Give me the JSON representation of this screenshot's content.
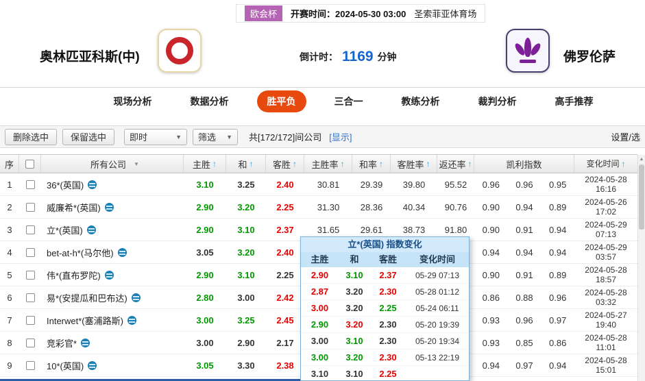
{
  "colors": {
    "tab": "#e8490f",
    "up": "#e60000",
    "down": "#009900",
    "flat": "#333333",
    "countdown": "#1565d0",
    "link": "#2a6fd0",
    "badge": "#b564b5",
    "sort": "#2aa5dc"
  },
  "icons": {
    "sort_arrow": "↑",
    "dropdown_arrow": "▼",
    "company_filter": "▼",
    "scroll_up": "▲"
  },
  "match_header": {
    "league_badge": "欧会杯",
    "kickoff": "开赛时间：2024-05-30 03:00",
    "venue": "圣索菲亚体育场",
    "home_team": "奥林匹亚科斯(中)",
    "away_team": "佛罗伦萨",
    "countdown_label": "倒计时：",
    "countdown_value": "1169",
    "countdown_unit": "分钟"
  },
  "tabs": {
    "items": [
      {
        "label": "现场分析",
        "state": "normal"
      },
      {
        "label": "数据分析",
        "state": "normal"
      },
      {
        "label": "胜平负",
        "state": "active"
      },
      {
        "label": "三合一",
        "state": "normal"
      },
      {
        "label": "教练分析",
        "state": "normal"
      },
      {
        "label": "裁判分析",
        "state": "normal"
      },
      {
        "label": "高手推荐",
        "state": "normal"
      }
    ]
  },
  "toolbar": {
    "delete_button": "删除选中",
    "keep_button": "保留选中",
    "time_select": "即时",
    "filter_select": "筛选",
    "company_count": "共[172/172]间公司",
    "show_link": "[显示]",
    "settings_link": "设置/选"
  },
  "table": {
    "headers": {
      "seq": "序",
      "company": "所有公司",
      "home": "主胜",
      "draw": "和",
      "away": "客胜",
      "home_rate": "主胜率",
      "draw_rate": "和率",
      "away_rate": "客胜率",
      "return_rate": "返还率",
      "kelly": "凯利指数",
      "change_time": "变化时间"
    },
    "rows": [
      {
        "seq": "1",
        "company": "36*(英国)",
        "home": "3.10",
        "home_trend": "down",
        "draw": "3.25",
        "draw_trend": "flat",
        "away": "2.40",
        "away_trend": "up",
        "home_rate": "30.81",
        "draw_rate": "29.39",
        "away_rate": "39.80",
        "return_rate": "95.52",
        "kelly_home": "0.96",
        "kelly_draw": "0.96",
        "kelly_away": "0.95",
        "change_date": "2024-05-28",
        "change_time": "16:16"
      },
      {
        "seq": "2",
        "company": "威廉希*(英国)",
        "home": "2.90",
        "home_trend": "down",
        "draw": "3.20",
        "draw_trend": "down",
        "away": "2.25",
        "away_trend": "up",
        "home_rate": "31.30",
        "draw_rate": "28.36",
        "away_rate": "40.34",
        "return_rate": "90.76",
        "kelly_home": "0.90",
        "kelly_draw": "0.94",
        "kelly_away": "0.89",
        "change_date": "2024-05-26",
        "change_time": "17:02"
      },
      {
        "seq": "3",
        "company": "立*(英国)",
        "home": "2.90",
        "home_trend": "down",
        "draw": "3.10",
        "draw_trend": "down",
        "away": "2.37",
        "away_trend": "up",
        "home_rate": "31.65",
        "draw_rate": "29.61",
        "away_rate": "38.73",
        "return_rate": "91.80",
        "kelly_home": "0.90",
        "kelly_draw": "0.91",
        "kelly_away": "0.94",
        "change_date": "2024-05-29",
        "change_time": "07:13"
      },
      {
        "seq": "4",
        "company": "bet-at-h*(马尔他)",
        "home": "3.05",
        "home_trend": "flat",
        "draw": "3.20",
        "draw_trend": "down",
        "away": "2.40",
        "away_trend": "up",
        "home_rate": "",
        "draw_rate": "",
        "away_rate": "",
        "return_rate": "",
        "kelly_home": "0.94",
        "kelly_draw": "0.94",
        "kelly_away": "0.94",
        "change_date": "2024-05-29",
        "change_time": "03:57"
      },
      {
        "seq": "5",
        "company": "伟*(直布罗陀)",
        "home": "2.90",
        "home_trend": "down",
        "draw": "3.10",
        "draw_trend": "down",
        "away": "2.25",
        "away_trend": "flat",
        "home_rate": "",
        "draw_rate": "",
        "away_rate": "",
        "return_rate": "",
        "kelly_home": "0.90",
        "kelly_draw": "0.91",
        "kelly_away": "0.89",
        "change_date": "2024-05-28",
        "change_time": "18:57"
      },
      {
        "seq": "6",
        "company": "易*(安提瓜和巴布达)",
        "home": "2.80",
        "home_trend": "down",
        "draw": "3.00",
        "draw_trend": "flat",
        "away": "2.42",
        "away_trend": "up",
        "home_rate": "",
        "draw_rate": "",
        "away_rate": "",
        "return_rate": "",
        "kelly_home": "0.86",
        "kelly_draw": "0.88",
        "kelly_away": "0.96",
        "change_date": "2024-05-28",
        "change_time": "03:32"
      },
      {
        "seq": "7",
        "company": "Interwet*(塞浦路斯)",
        "home": "3.00",
        "home_trend": "down",
        "draw": "3.25",
        "draw_trend": "down",
        "away": "2.45",
        "away_trend": "up",
        "home_rate": "",
        "draw_rate": "",
        "away_rate": "",
        "return_rate": "",
        "kelly_home": "0.93",
        "kelly_draw": "0.96",
        "kelly_away": "0.97",
        "change_date": "2024-05-27",
        "change_time": "19:40"
      },
      {
        "seq": "8",
        "company": "竞彩官*",
        "home": "3.00",
        "home_trend": "flat",
        "draw": "2.90",
        "draw_trend": "flat",
        "away": "2.17",
        "away_trend": "flat",
        "home_rate": "",
        "draw_rate": "",
        "away_rate": "",
        "return_rate": "",
        "kelly_home": "0.93",
        "kelly_draw": "0.85",
        "kelly_away": "0.86",
        "change_date": "2024-05-28",
        "change_time": "11:01"
      },
      {
        "seq": "9",
        "company": "10*(英国)",
        "home": "3.05",
        "home_trend": "down",
        "draw": "3.30",
        "draw_trend": "flat",
        "away": "2.38",
        "away_trend": "up",
        "home_rate": "",
        "draw_rate": "",
        "away_rate": "",
        "return_rate": "",
        "kelly_home": "0.94",
        "kelly_draw": "0.97",
        "kelly_away": "0.94",
        "change_date": "2024-05-28",
        "change_time": "15:01"
      }
    ]
  },
  "popup": {
    "title": "立*(英国) 指数变化",
    "col_home": "主胜",
    "col_draw": "和",
    "col_away": "客胜",
    "col_time": "变化时间",
    "rows": [
      {
        "home": "2.90",
        "home_trend": "up",
        "draw": "3.10",
        "draw_trend": "down",
        "away": "2.37",
        "away_trend": "up",
        "time": "05-29 07:13"
      },
      {
        "home": "2.87",
        "home_trend": "up",
        "draw": "3.20",
        "draw_trend": "flat",
        "away": "2.30",
        "away_trend": "up",
        "time": "05-28 01:12"
      },
      {
        "home": "3.00",
        "home_trend": "up",
        "draw": "3.20",
        "draw_trend": "flat",
        "away": "2.25",
        "away_trend": "down",
        "time": "05-24 06:11"
      },
      {
        "home": "2.90",
        "home_trend": "down",
        "draw": "3.20",
        "draw_trend": "up",
        "away": "2.30",
        "away_trend": "flat",
        "time": "05-20 19:39"
      },
      {
        "home": "3.00",
        "home_trend": "flat",
        "draw": "3.10",
        "draw_trend": "down",
        "away": "2.30",
        "away_trend": "flat",
        "time": "05-20 19:34"
      },
      {
        "home": "3.00",
        "home_trend": "down",
        "draw": "3.20",
        "draw_trend": "down",
        "away": "2.30",
        "away_trend": "up",
        "time": "05-13 22:19"
      },
      {
        "home": "3.10",
        "home_trend": "flat",
        "draw": "3.10",
        "draw_trend": "flat",
        "away": "2.25",
        "away_trend": "up",
        "time": ""
      }
    ]
  }
}
